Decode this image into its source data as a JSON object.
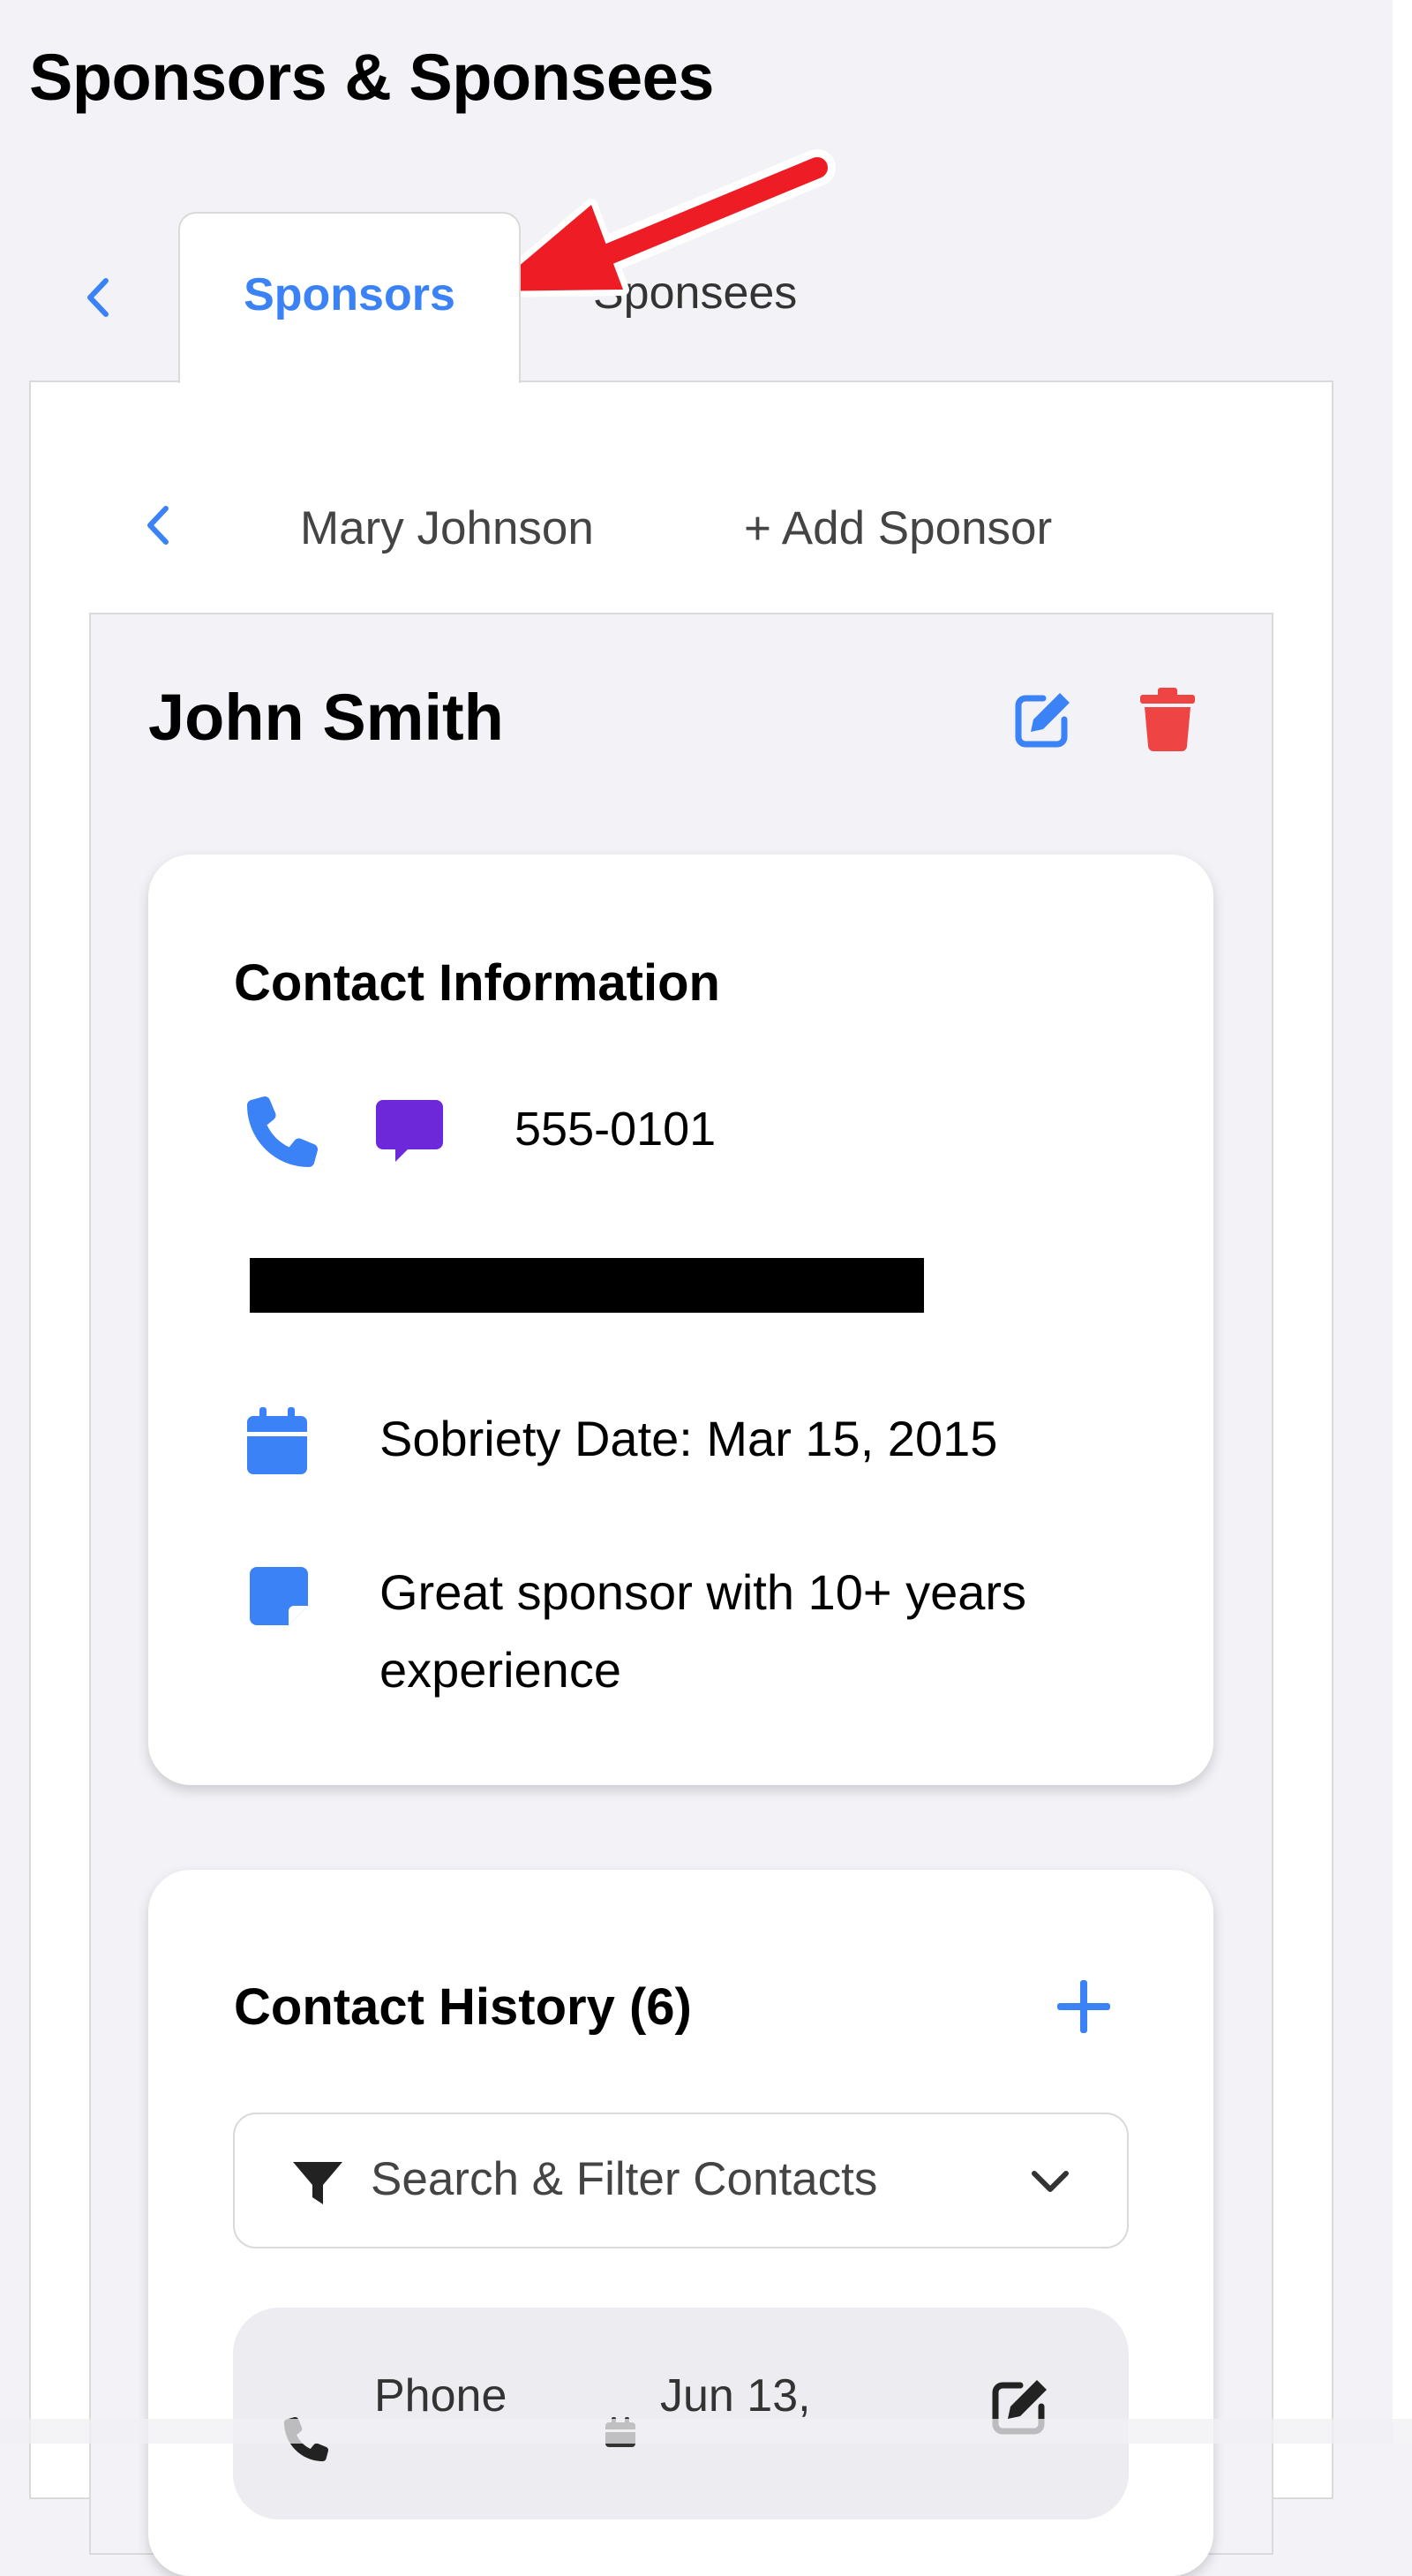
{
  "page": {
    "title": "Sponsors & Sponsees"
  },
  "outer_tabs": {
    "active": "Sponsors",
    "inactive": "Sponsees"
  },
  "inner_tabs": {
    "current": "Mary Johnson",
    "add": "+ Add Sponsor"
  },
  "sponsor": {
    "name": "John Smith"
  },
  "contact_info": {
    "title": "Contact Information",
    "phone": "555-0101",
    "sobriety": "Sobriety Date: Mar 15, 2015",
    "notes": "Great sponsor with 10+ years experience"
  },
  "contact_history": {
    "title": "Contact History (6)",
    "filter_label": "Search & Filter Contacts",
    "first_item": {
      "type": "Phone",
      "date": "Jun 13,"
    }
  },
  "colors": {
    "accent_blue": "#3b82f6",
    "danger_red": "#ef4444",
    "message_purple": "#6d28d9",
    "annotation_arrow": "#ee1c25"
  }
}
